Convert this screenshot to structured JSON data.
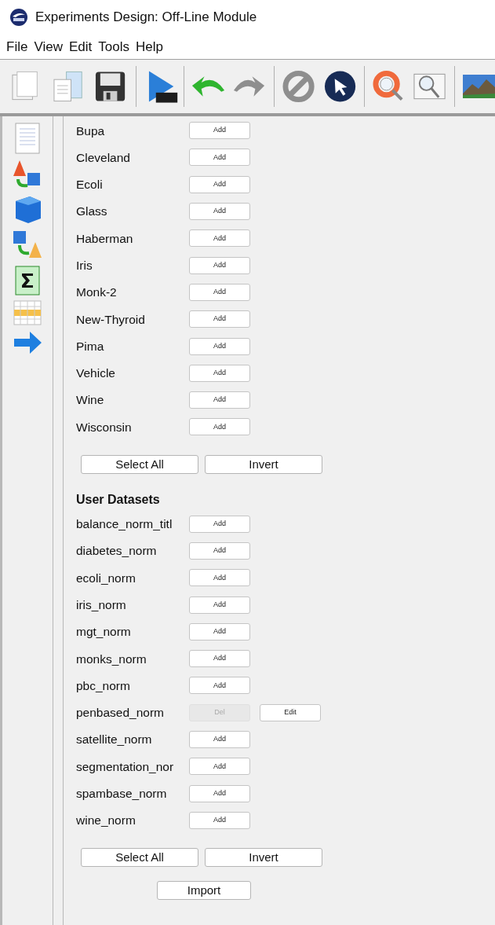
{
  "window": {
    "title": "Experiments Design: Off-Line Module"
  },
  "menu": [
    "File",
    "View",
    "Edit",
    "Tools",
    "Help"
  ],
  "datasets": [
    {
      "name": "Bupa",
      "buttons": [
        {
          "label": "Add",
          "disabled": false
        }
      ]
    },
    {
      "name": "Cleveland",
      "buttons": [
        {
          "label": "Add",
          "disabled": false
        }
      ]
    },
    {
      "name": "Ecoli",
      "buttons": [
        {
          "label": "Add",
          "disabled": false
        }
      ]
    },
    {
      "name": "Glass",
      "buttons": [
        {
          "label": "Add",
          "disabled": false
        }
      ]
    },
    {
      "name": "Haberman",
      "buttons": [
        {
          "label": "Add",
          "disabled": false
        }
      ]
    },
    {
      "name": "Iris",
      "buttons": [
        {
          "label": "Add",
          "disabled": false
        }
      ]
    },
    {
      "name": "Monk-2",
      "buttons": [
        {
          "label": "Add",
          "disabled": false
        }
      ]
    },
    {
      "name": "New-Thyroid",
      "buttons": [
        {
          "label": "Add",
          "disabled": false
        }
      ]
    },
    {
      "name": "Pima",
      "buttons": [
        {
          "label": "Add",
          "disabled": false
        }
      ]
    },
    {
      "name": "Vehicle",
      "buttons": [
        {
          "label": "Add",
          "disabled": false
        }
      ]
    },
    {
      "name": "Wine",
      "buttons": [
        {
          "label": "Add",
          "disabled": false
        }
      ]
    },
    {
      "name": "Wisconsin",
      "buttons": [
        {
          "label": "Add",
          "disabled": false
        }
      ]
    }
  ],
  "datasets_actions": [
    "Select All",
    "Invert"
  ],
  "user_datasets": {
    "title": "User Datasets",
    "items": [
      {
        "name": "balance_norm_titl",
        "buttons": [
          {
            "label": "Add",
            "disabled": false
          }
        ]
      },
      {
        "name": "diabetes_norm",
        "buttons": [
          {
            "label": "Add",
            "disabled": false
          }
        ]
      },
      {
        "name": "ecoli_norm",
        "buttons": [
          {
            "label": "Add",
            "disabled": false
          }
        ]
      },
      {
        "name": "iris_norm",
        "buttons": [
          {
            "label": "Add",
            "disabled": false
          }
        ]
      },
      {
        "name": "mgt_norm",
        "buttons": [
          {
            "label": "Add",
            "disabled": false
          }
        ]
      },
      {
        "name": "monks_norm",
        "buttons": [
          {
            "label": "Add",
            "disabled": false
          }
        ]
      },
      {
        "name": "pbc_norm",
        "buttons": [
          {
            "label": "Add",
            "disabled": false
          }
        ]
      },
      {
        "name": "penbased_norm",
        "buttons": [
          {
            "label": "Del",
            "disabled": true
          },
          {
            "label": "Edit",
            "disabled": false
          }
        ]
      },
      {
        "name": "satellite_norm",
        "buttons": [
          {
            "label": "Add",
            "disabled": false
          }
        ]
      },
      {
        "name": "segmentation_nor",
        "buttons": [
          {
            "label": "Add",
            "disabled": false
          }
        ]
      },
      {
        "name": "spambase_norm",
        "buttons": [
          {
            "label": "Add",
            "disabled": false
          }
        ]
      },
      {
        "name": "wine_norm",
        "buttons": [
          {
            "label": "Add",
            "disabled": false
          }
        ]
      }
    ],
    "actions": [
      "Select All",
      "Invert"
    ],
    "import_button": "Import"
  }
}
